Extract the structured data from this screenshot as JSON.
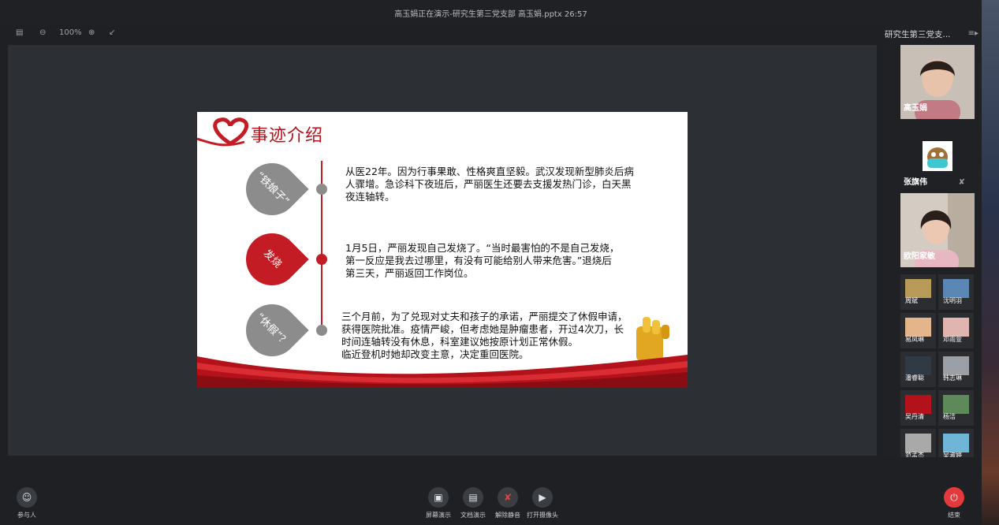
{
  "window": {
    "title": "高玉娟正在演示-研究生第三党支部 高玉娟.pptx 26:57",
    "controls": [
      "pin-icon",
      "minimize-icon",
      "restore-icon",
      "close-icon"
    ]
  },
  "toolbar": {
    "zoom": "100%"
  },
  "slide": {
    "title": "事迹介绍",
    "items": [
      {
        "label": "“铁娘子”",
        "text": "从医22年。因为行事果敢、性格爽直坚毅。武汉发现新型肺炎后病\n人骤增。急诊科下夜班后，严丽医生还要去支援发热门诊，白天黑\n夜连轴转。"
      },
      {
        "label": "发烧",
        "text": "1月5日，严丽发现自己发烧了。“当时最害怕的不是自己发烧，\n第一反应是我去过哪里，有没有可能给别人带来危害。”退烧后\n第三天，严丽返回工作岗位。"
      },
      {
        "label": "“休假”？",
        "text": "三个月前，为了兑现对丈夫和孩子的承诺，严丽提交了休假申请，\n获得医院批准。疫情严峻，但考虑她是肿瘤患者，开过4次刀，长\n时间连轴转没有休息，科室建议她按原计划正常休假。\n临近登机时她却改变主意，决定重回医院。"
      }
    ],
    "colors": {
      "red": "#c41c24",
      "grey": "#8c8c8c"
    }
  },
  "panel": {
    "meeting_name": "研究生第三党支...",
    "big_participants": [
      {
        "name": "高玉娟"
      },
      {
        "name": "张旗伟"
      },
      {
        "name": "欧阳家敏"
      }
    ],
    "small_participants": [
      {
        "name": "周斌"
      },
      {
        "name": "沈明羽"
      },
      {
        "name": "易凤琳"
      },
      {
        "name": "邓雨萱"
      },
      {
        "name": "潘睿聪"
      },
      {
        "name": "韩志琳"
      },
      {
        "name": "吴丹清"
      },
      {
        "name": "杨洁"
      },
      {
        "name": "范孟杰"
      },
      {
        "name": "吴淑婷"
      }
    ]
  },
  "bottom": {
    "participants": "参与人",
    "screen_share": "屏幕演示",
    "doc_share": "文档演示",
    "unmute": "解除静音",
    "camera": "打开摄像头",
    "end": "结束"
  }
}
